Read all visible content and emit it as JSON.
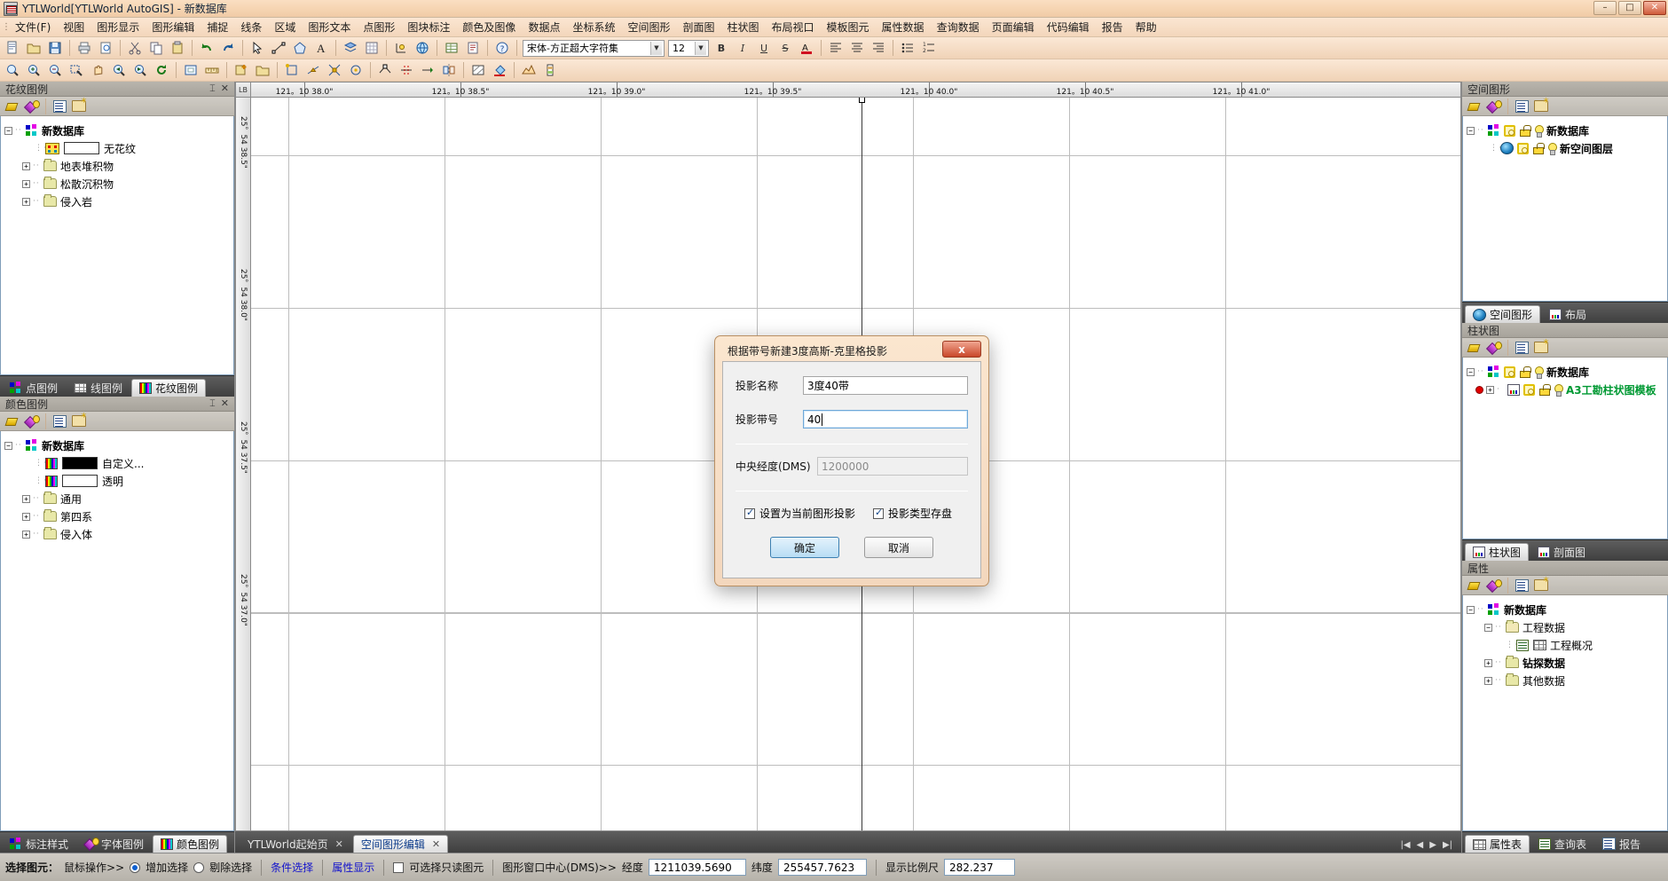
{
  "window": {
    "title": "YTLWorld[YTLWorld AutoGIS] - 新数据库",
    "minimize": "–",
    "maximize": "□",
    "close": "✕"
  },
  "menubar": {
    "items": [
      "文件(F)",
      "视图",
      "图形显示",
      "图形编辑",
      "捕捉",
      "线条",
      "区域",
      "图形文本",
      "点图形",
      "图块标注",
      "颜色及图像",
      "数据点",
      "坐标系统",
      "空间图形",
      "剖面图",
      "柱状图",
      "布局视口",
      "模板图元",
      "属性数据",
      "查询数据",
      "页面编辑",
      "代码编辑",
      "报告",
      "帮助"
    ]
  },
  "toolbar2": {
    "font_name": "宋体-方正超大字符集",
    "font_size": "12",
    "bold": "B",
    "italic": "I",
    "underline": "U",
    "strike": "S",
    "color_a": "A"
  },
  "left": {
    "panel_pattern": {
      "title": "花纹图例",
      "pin": "⌶",
      "close": "✕",
      "tree": {
        "root": "新数据库",
        "items": [
          {
            "label": "无花纹",
            "type": "pattern-swatch"
          },
          {
            "label": "地表堆积物",
            "type": "folder"
          },
          {
            "label": "松散沉积物",
            "type": "folder"
          },
          {
            "label": "侵入岩",
            "type": "folder"
          }
        ]
      },
      "tabs": [
        {
          "label": "点图例",
          "active": false
        },
        {
          "label": "线图例",
          "active": false
        },
        {
          "label": "花纹图例",
          "active": true
        }
      ]
    },
    "panel_color": {
      "title": "颜色图例",
      "pin": "⌶",
      "close": "✕",
      "tree": {
        "root": "新数据库",
        "items": [
          {
            "label": "自定义...",
            "type": "color-black"
          },
          {
            "label": "透明",
            "type": "color-none"
          },
          {
            "label": "通用",
            "type": "folder"
          },
          {
            "label": "第四系",
            "type": "folder"
          },
          {
            "label": "侵入体",
            "type": "folder"
          }
        ]
      },
      "tabs": [
        {
          "label": "标注样式",
          "active": false
        },
        {
          "label": "字体图例",
          "active": false
        },
        {
          "label": "颜色图例",
          "active": true
        }
      ]
    }
  },
  "right": {
    "panel_spatial": {
      "title": "空间图形",
      "tree": {
        "root": "新数据库",
        "items": [
          {
            "label": "新空间图层",
            "type": "layer"
          }
        ]
      },
      "tabs": [
        {
          "label": "空间图形",
          "active": true
        },
        {
          "label": "布局",
          "active": false
        }
      ]
    },
    "panel_column": {
      "title": "柱状图",
      "tree": {
        "root": "新数据库",
        "items": [
          {
            "label": "A3工勘柱状图模板",
            "type": "template"
          }
        ]
      },
      "tabs": [
        {
          "label": "柱状图",
          "active": true
        },
        {
          "label": "剖面图",
          "active": false
        }
      ]
    },
    "panel_attr": {
      "title": "属性",
      "tree": {
        "root": "新数据库",
        "items": [
          {
            "label": "工程数据",
            "type": "folder-open"
          },
          {
            "label": "工程概况",
            "type": "table"
          },
          {
            "label": "钻探数据",
            "type": "folder"
          },
          {
            "label": "其他数据",
            "type": "folder"
          }
        ]
      },
      "tabs": [
        {
          "label": "属性表",
          "active": true
        },
        {
          "label": "查询表",
          "active": false
        },
        {
          "label": "报告",
          "active": false
        }
      ]
    }
  },
  "canvas": {
    "corner_label": "LB",
    "h_ticks": [
      "121。10 38.0\"",
      "121。10 38.5\"",
      "121。10 39.0\"",
      "121。10 39.5\"",
      "121。10 40.0\"",
      "121。10 40.5\"",
      "121。10 41.0\""
    ],
    "v_ticks": [
      "25。54 38.5\"",
      "25。54 38.0\"",
      "25。54 37.5\"",
      "25。54 37.0\""
    ],
    "doc_tabs": [
      {
        "label": "YTLWorld起始页",
        "active": false,
        "close": "✕"
      },
      {
        "label": "空间图形编辑",
        "active": true,
        "close": "✕"
      }
    ],
    "nav": [
      "|◀",
      "◀",
      "▶",
      "▶|"
    ]
  },
  "dialog": {
    "title": "根据带号新建3度高斯-克里格投影",
    "close": "x",
    "fields": [
      {
        "label": "投影名称",
        "value": "3度40带",
        "focused": false,
        "readonly": false
      },
      {
        "label": "投影带号",
        "value": "40",
        "focused": true,
        "readonly": false
      }
    ],
    "central_meridian": {
      "label": "中央经度(DMS)",
      "value": "1200000",
      "readonly": true
    },
    "checkboxes": [
      {
        "label": "设置为当前图形投影",
        "checked": true
      },
      {
        "label": "投影类型存盘",
        "checked": true
      }
    ],
    "buttons": {
      "ok": "确定",
      "cancel": "取消"
    }
  },
  "statusbar": {
    "select_label": "选择图元：",
    "mouse_op": "鼠标操作>>",
    "radio_add": "增加选择",
    "radio_remove": "剔除选择",
    "link_condition": "条件选择",
    "link_attr": "属性显示",
    "chk_readonly": "可选择只读图元",
    "window_center": "图形窗口中心(DMS)>>",
    "lon_label": "经度",
    "lon_value": "1211039.5690",
    "lat_label": "纬度",
    "lat_value": "255457.7623",
    "scale_label": "显示比例尺",
    "scale_value": "282.237"
  },
  "colors": {
    "accent": "#f3d7bd",
    "panel_header": "#a7a39b",
    "tab_bar": "#3f3f3f",
    "link": "#1111cc",
    "selection_blue": "#3c7fb1",
    "template_green": "#009933",
    "dialog_border": "#b98f63"
  }
}
